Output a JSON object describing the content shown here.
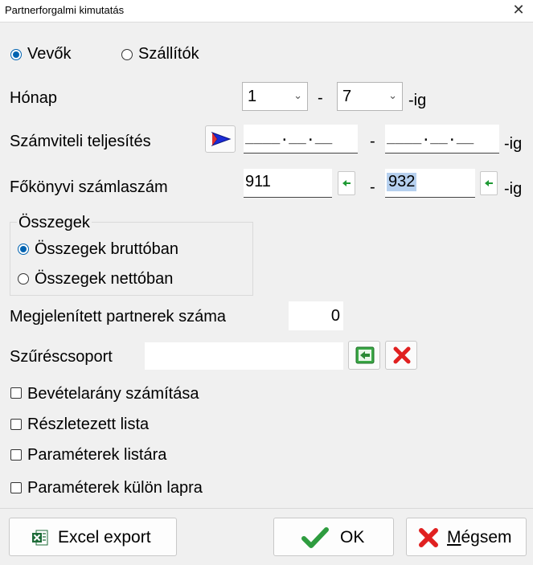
{
  "window": {
    "title": "Partnerforgalmi kimutatás",
    "close_glyph": "✕"
  },
  "partner_type": {
    "options": [
      {
        "label": "Vevők",
        "checked": true
      },
      {
        "label": "Szállítók",
        "checked": false
      }
    ]
  },
  "month": {
    "label": "Hónap",
    "from": "1",
    "to": "7",
    "separator": "-",
    "suffix": "-ig"
  },
  "accounting_date": {
    "label": "Számviteli teljesítés",
    "from_mask": "____.__.__",
    "to_mask": "____.__.__",
    "separator": "-",
    "suffix": "-ig"
  },
  "ledger_account": {
    "label": "Főkönyvi számlaszám",
    "from": "911",
    "to": "932",
    "separator": "-",
    "suffix": "-ig"
  },
  "amounts": {
    "legend": "Összegek",
    "options": [
      {
        "label": "Összegek bruttóban",
        "checked": true
      },
      {
        "label": "Összegek nettóban",
        "checked": false
      }
    ]
  },
  "partner_count": {
    "label": "Megjelenített partnerek száma",
    "value": "0"
  },
  "filter_group": {
    "label": "Szűréscsoport",
    "value": ""
  },
  "checkboxes": [
    {
      "label": "Bevételarány számítása",
      "checked": false
    },
    {
      "label": "Részletezett lista",
      "checked": false
    },
    {
      "label": "Paraméterek listára",
      "checked": false
    },
    {
      "label": "Paraméterek külön lapra",
      "checked": false
    }
  ],
  "buttons": {
    "excel": "Excel export",
    "ok": "OK",
    "cancel": "Mégsem"
  },
  "colors": {
    "accent": "#0063b1",
    "ok_check": "#2e9c3f",
    "cancel_x": "#e02020",
    "selection": "#b6d0ef"
  }
}
